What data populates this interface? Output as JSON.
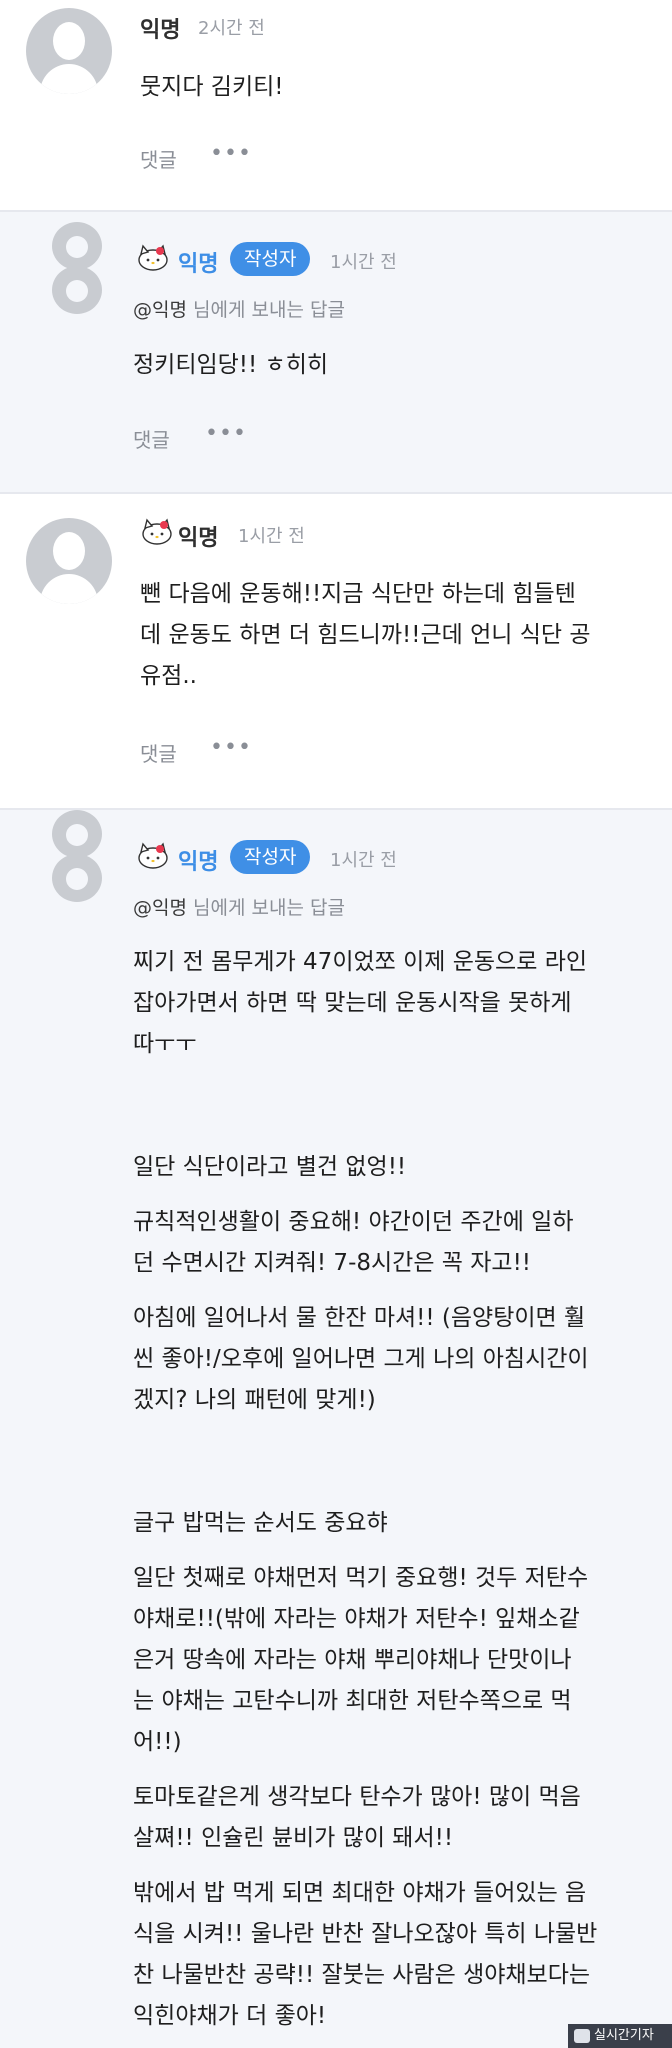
{
  "comments": [
    {
      "author": "익명",
      "time": "2시간 전",
      "text": "뭇지다 김키티!",
      "reply_label": "댓글",
      "more": "•••"
    },
    {
      "author": "익명",
      "badge": "작성자",
      "time": "1시간 전",
      "mention": "@익명",
      "mention_suffix": "님에게 보내는 답글",
      "text": "정키티임당!! ㅎ히히",
      "reply_label": "댓글",
      "more": "•••"
    },
    {
      "author": "익명",
      "time": "1시간 전",
      "text_lines": [
        "뺀 다음에 운동해!!지금 식단만 하는데 힘들텐",
        "데 운동도 하면 더 힘드니까!!근데 언니 식단 공",
        "유점.."
      ],
      "reply_label": "댓글",
      "more": "•••"
    },
    {
      "author": "익명",
      "badge": "작성자",
      "time": "1시간 전",
      "mention": "@익명",
      "mention_suffix": "님에게 보내는 답글",
      "paragraphs": [
        "찌기 전 몸무게가 47이었쪼 이제 운동으로 라인",
        "잡아가면서 하면 딱 맞는데 운동시작을 못하게",
        "따ㅜㅜ",
        "일단 식단이라고 별건 없엉!!",
        "규칙적인생활이 중요해! 야간이던 주간에 일하",
        "던 수면시간 지켜줘! 7-8시간은 꼭 자고!!",
        "아침에 일어나서 물 한잔 마셔!! (음양탕이면 훨",
        "씬 좋아!/오후에 일어나면 그게 나의 아침시간이",
        "겠지? 나의 패턴에 맞게!)",
        "글구 밥먹는 순서도 중요햐",
        "일단 첫째로 야채먼저 먹기 중요행! 것두 저탄수",
        "야채로!!(밖에 자라는 야채가 저탄수! 잎채소같",
        "은거 땅속에 자라는 야채 뿌리야채나 단맛이나",
        "는 야채는 고탄수니까 최대한 저탄수쪽으로 먹",
        "어!!)",
        "토마토같은게 생각보다 탄수가 많아! 많이 먹음",
        "살쪄!! 인슐린 뷴비가 많이 돼서!!",
        "밖에서 밥 먹게 되면 최대한 야채가 들어있는 음",
        "식을 시켜!! 울나란 반찬 잘나오잖아 특히 나물반",
        "찬 나물반찬 공략!! 잘붓는 사람은 생야채보다는",
        "익힌야채가 더 좋아!"
      ]
    }
  ],
  "watermark": "실시간기자",
  "colors": {
    "accent": "#3f8fe6",
    "reply_bg": "#f4f6fa",
    "avatar": "#c9ccd1"
  }
}
